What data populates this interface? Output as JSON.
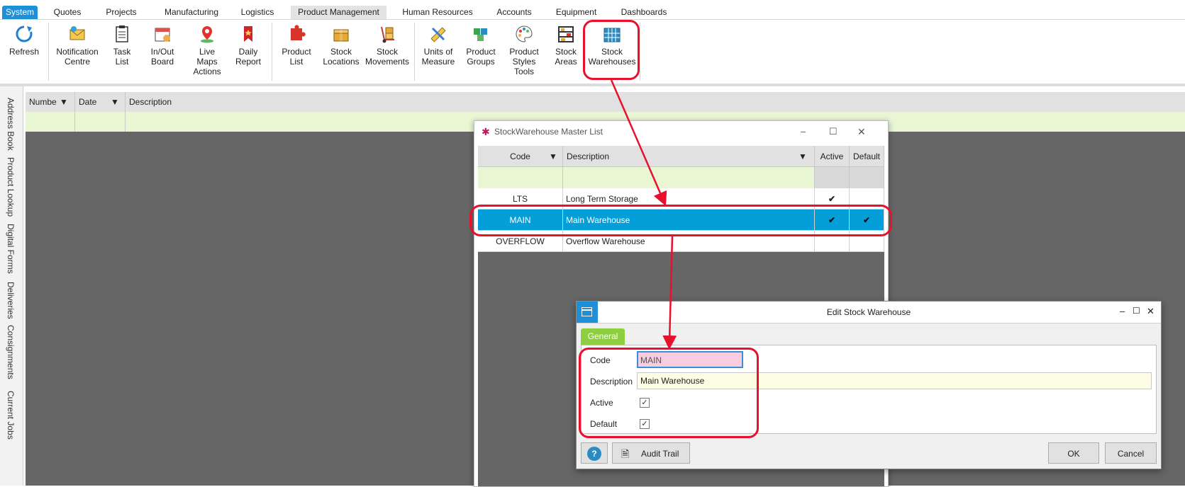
{
  "menu": {
    "tabs": [
      "System",
      "Quotes",
      "Projects",
      "Manufacturing",
      "Logistics",
      "Product Management",
      "Human Resources",
      "Accounts",
      "Equipment",
      "Dashboards"
    ]
  },
  "ribbon": {
    "refresh": "Refresh",
    "notification": "Notification\nCentre",
    "task_list": "Task\nList",
    "inout_board": "In/Out\nBoard",
    "live_maps": "Live\nMaps\nActions",
    "daily_report": "Daily\nReport",
    "product_list": "Product\nList",
    "stock_locations": "Stock\nLocations",
    "stock_movements": "Stock\nMovements",
    "units_measure": "Units of\nMeasure",
    "product_groups": "Product\nGroups",
    "product_styles": "Product\nStyles\nTools",
    "stock_areas": "Stock\nAreas",
    "stock_warehouses": "Stock\nWarehouses"
  },
  "sidebar": {
    "tabs": [
      "Address Book",
      "Product Lookup",
      "Digital Forms",
      "Deliveries",
      "Consignments",
      "Current Jobs"
    ]
  },
  "bg_grid": {
    "columns": [
      "Numbe",
      "Date",
      "Description"
    ]
  },
  "master_list": {
    "title": "StockWarehouse Master List",
    "columns": {
      "code": "Code",
      "description": "Description",
      "active": "Active",
      "default": "Default"
    },
    "rows": [
      {
        "code": "LTS",
        "description": "Long Term Storage",
        "active": true,
        "default": false
      },
      {
        "code": "MAIN",
        "description": "Main Warehouse",
        "active": true,
        "default": true
      },
      {
        "code": "OVERFLOW",
        "description": "Overflow Warehouse",
        "active": false,
        "default": false
      }
    ]
  },
  "edit": {
    "title": "Edit Stock Warehouse",
    "tab_general": "General",
    "code_label": "Code",
    "code_value": "MAIN",
    "description_label": "Description",
    "description_value": "Main Warehouse",
    "active_label": "Active",
    "default_label": "Default",
    "audit_trail": "Audit Trail",
    "ok": "OK",
    "cancel": "Cancel"
  },
  "colors": {
    "accent": "#049fd9",
    "filter_row": "#e8f6d4",
    "annotation": "#e8112d",
    "tab_green": "#8dcf3f"
  }
}
